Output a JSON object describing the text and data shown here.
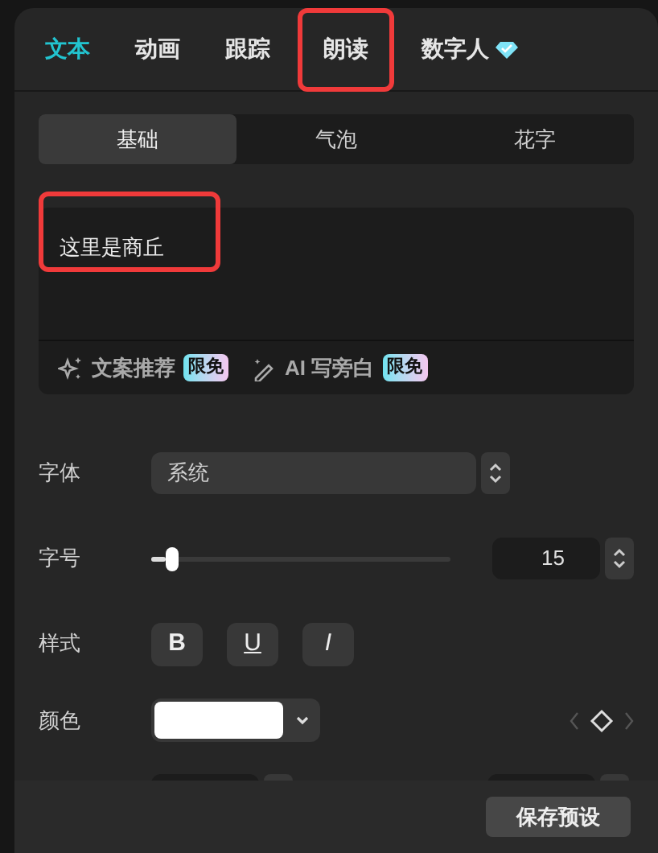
{
  "tabs": [
    {
      "label": "文本",
      "selected": true,
      "highlighted": false,
      "badge": false
    },
    {
      "label": "动画",
      "selected": false,
      "highlighted": false,
      "badge": false
    },
    {
      "label": "跟踪",
      "selected": false,
      "highlighted": false,
      "badge": false
    },
    {
      "label": "朗读",
      "selected": false,
      "highlighted": true,
      "badge": false
    },
    {
      "label": "数字人",
      "selected": false,
      "highlighted": false,
      "badge": true
    }
  ],
  "subtabs": [
    {
      "label": "基础",
      "selected": true
    },
    {
      "label": "气泡",
      "selected": false
    },
    {
      "label": "花字",
      "selected": false
    }
  ],
  "text_box": {
    "value": "这里是商丘",
    "highlighted": true
  },
  "text_tools": [
    {
      "kind": "sparkle",
      "label": "文案推荐",
      "badge": "限免"
    },
    {
      "kind": "wand",
      "label": "AI 写旁白",
      "badge": "限免"
    }
  ],
  "font": {
    "label": "字体",
    "value": "系统"
  },
  "size": {
    "label": "字号",
    "level": 0.05,
    "value": "15"
  },
  "style": {
    "label": "样式",
    "buttons": [
      {
        "kind": "bold",
        "glyph": "B"
      },
      {
        "kind": "underline",
        "glyph": "U"
      },
      {
        "kind": "italic",
        "glyph": "I"
      }
    ]
  },
  "color": {
    "label": "颜色",
    "color": "#ffffff"
  },
  "save_button": "保存预设"
}
